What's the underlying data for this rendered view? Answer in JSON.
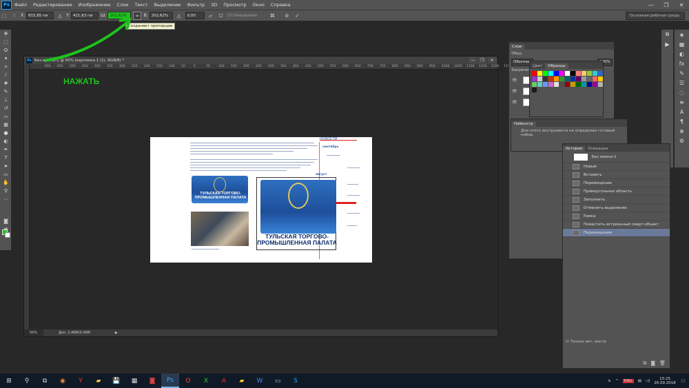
{
  "app": {
    "logo": "Ps"
  },
  "menu": [
    "Файл",
    "Редактирование",
    "Изображение",
    "Слои",
    "Текст",
    "Выделение",
    "Фильтр",
    "3D",
    "Просмотр",
    "Окно",
    "Справка"
  ],
  "options": {
    "x_label": "X:",
    "x_value": "815,85 пи",
    "y_label": "Y:",
    "y_value": "421,63 пи",
    "w_label": "Ш:",
    "w_value": "202,62%",
    "h_label": "В:",
    "h_value": "202,62%",
    "angle_value": "0,00",
    "interp_label": "Отламывание",
    "link_glyph": "∞",
    "workspace": "Основная рабочая среда"
  },
  "tooltip": "Сохраняет пропорции",
  "annotation": "НАЖАТЬ",
  "annotation_color": "#1ec21e",
  "document": {
    "title": "Без имени-1 @ 50% (картинка 1 (1), RGB/8) *",
    "ruler_ticks": [
      "600",
      "650",
      "500",
      "450",
      "400",
      "350",
      "300",
      "250",
      "200",
      "150",
      "100",
      "50",
      "0",
      "50",
      "100",
      "150",
      "200",
      "250",
      "300",
      "350",
      "400",
      "450",
      "500",
      "550",
      "600",
      "650",
      "700",
      "750",
      "800",
      "850",
      "900",
      "950",
      "1000",
      "1050",
      "1100",
      "1150",
      "1200",
      "1250"
    ],
    "zoom": "50%",
    "doc_size": "Док: 2,46M/3,49M"
  },
  "page": {
    "news_heading": "НОВОСТИ",
    "month1": "сентябрь",
    "month2": "август",
    "flag_text": "ТУЛЬСКАЯ ТОРГОВО-ПРОМЫШЛЕННАЯ ПАЛАТА"
  },
  "layers_panel": {
    "tabs": [
      "Слои"
    ],
    "kind_label": "Вид",
    "mode": "Обычные",
    "lock": "Закрепить",
    "opacity": "100%"
  },
  "swatches_panel": {
    "tabs": [
      "Цвет",
      "Образцы"
    ],
    "colors": [
      "#ff0000",
      "#ffff00",
      "#00ff00",
      "#00ffff",
      "#0000ff",
      "#ff00ff",
      "#ffffff",
      "#000000",
      "#ff8080",
      "#ffcc66",
      "#99cc33",
      "#33cccc",
      "#3366cc",
      "#9933cc",
      "#cccccc",
      "#333333",
      "#cc3300",
      "#ff9900",
      "#339933",
      "#006666",
      "#003399",
      "#660066",
      "#999999",
      "#666666",
      "#ff6666",
      "#ffcc00",
      "#66cc66",
      "#66cccc",
      "#6699ff",
      "#cc66cc",
      "#e0e0e0",
      "#4d4d4d",
      "#990000",
      "#cc9900",
      "#006600",
      "#009999",
      "#000099",
      "#990099",
      "#b3b3b3",
      "#1a1a1a"
    ]
  },
  "nav_panel": {
    "tab": "Набинстр",
    "message": "Для этого инструмента не определен готовый набор."
  },
  "history_panel": {
    "tabs": [
      "История",
      "Операции"
    ],
    "snapshot": "Без имени-1",
    "items": [
      "Новый",
      "Вставить",
      "Перемещение",
      "Прямоугольная область",
      "Заполнить",
      "Отменить выделение",
      "Рамка",
      "Поместить встроенный смарт-объект",
      "Перемещение"
    ],
    "footer": "Только акт. инстр"
  },
  "taskbar": {
    "time": "15:25",
    "date": "26.09.2018",
    "lang": "ENG"
  }
}
